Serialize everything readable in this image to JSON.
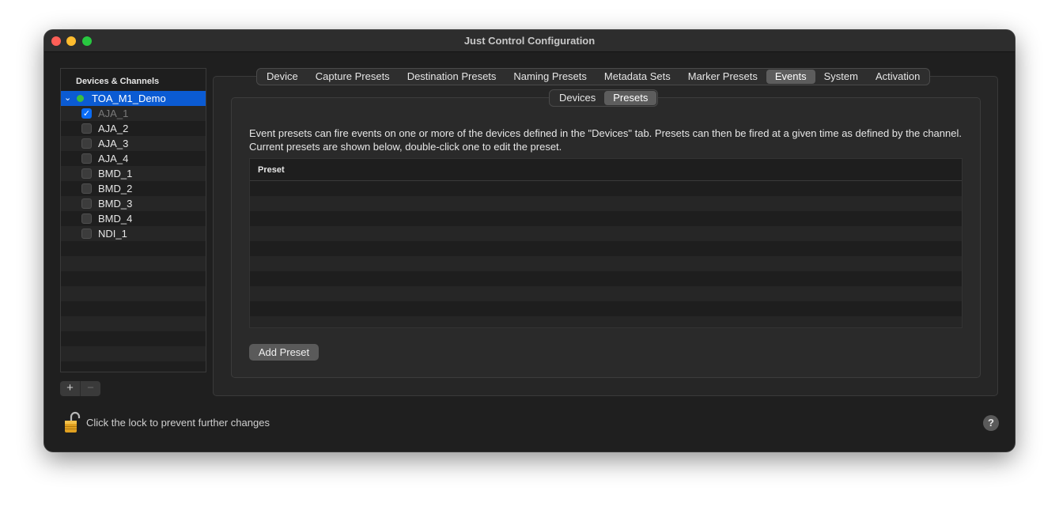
{
  "window": {
    "title": "Just Control Configuration"
  },
  "sidebar": {
    "header": "Devices & Channels",
    "group": {
      "label": "TOA_M1_Demo",
      "expanded": true,
      "status_color": "#3bbf3f"
    },
    "channels": [
      {
        "label": "AJA_1",
        "checked": true,
        "dimmed": true
      },
      {
        "label": "AJA_2",
        "checked": false
      },
      {
        "label": "AJA_3",
        "checked": false
      },
      {
        "label": "AJA_4",
        "checked": false
      },
      {
        "label": "BMD_1",
        "checked": false
      },
      {
        "label": "BMD_2",
        "checked": false
      },
      {
        "label": "BMD_3",
        "checked": false
      },
      {
        "label": "BMD_4",
        "checked": false
      },
      {
        "label": "NDI_1",
        "checked": false
      }
    ],
    "add_label": "+",
    "remove_label": "−"
  },
  "tabs": [
    {
      "label": "Device"
    },
    {
      "label": "Capture Presets"
    },
    {
      "label": "Destination Presets"
    },
    {
      "label": "Naming Presets"
    },
    {
      "label": "Metadata Sets"
    },
    {
      "label": "Marker Presets"
    },
    {
      "label": "Events",
      "active": true
    },
    {
      "label": "System"
    },
    {
      "label": "Activation"
    }
  ],
  "subtabs": [
    {
      "label": "Devices"
    },
    {
      "label": "Presets",
      "active": true
    }
  ],
  "events": {
    "description": "Event presets can fire events on one or more of the devices defined in the \"Devices\" tab. Presets can then be fired at a given time as defined by the channel. Current presets are shown below, double-click one to edit the preset.",
    "table_header": "Preset",
    "add_button": "Add Preset"
  },
  "footer": {
    "lock_text": "Click the lock to prevent further changes",
    "help_label": "?"
  },
  "colors": {
    "selection": "#0b5bd3",
    "checkbox_checked": "#0a6cf5",
    "status_green": "#3bbf3f"
  }
}
